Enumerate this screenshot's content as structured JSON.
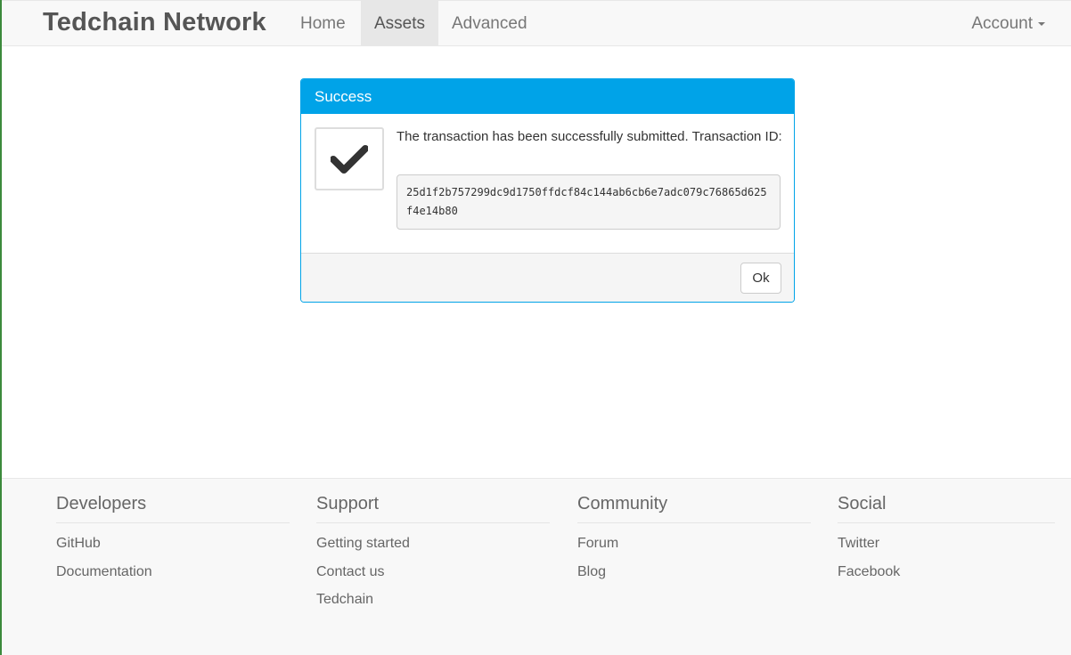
{
  "navbar": {
    "brand": "Tedchain Network",
    "items": [
      {
        "label": "Home",
        "active": false
      },
      {
        "label": "Assets",
        "active": true
      },
      {
        "label": "Advanced",
        "active": false
      }
    ],
    "account_label": "Account"
  },
  "dialog": {
    "title": "Success",
    "message": "The transaction has been successfully submitted. Transaction ID:",
    "transaction_id": "25d1f2b757299dc9d1750ffdcf84c144ab6cb6e7adc079c76865d625f4e14b80",
    "ok_label": "Ok",
    "icon": "checkmark-icon",
    "header_color": "#00a3e8"
  },
  "footer": {
    "columns": [
      {
        "title": "Developers",
        "links": [
          "GitHub",
          "Documentation"
        ]
      },
      {
        "title": "Support",
        "links": [
          "Getting started",
          "Contact us",
          "Tedchain"
        ]
      },
      {
        "title": "Community",
        "links": [
          "Forum",
          "Blog"
        ]
      },
      {
        "title": "Social",
        "links": [
          "Twitter",
          "Facebook"
        ]
      }
    ]
  }
}
